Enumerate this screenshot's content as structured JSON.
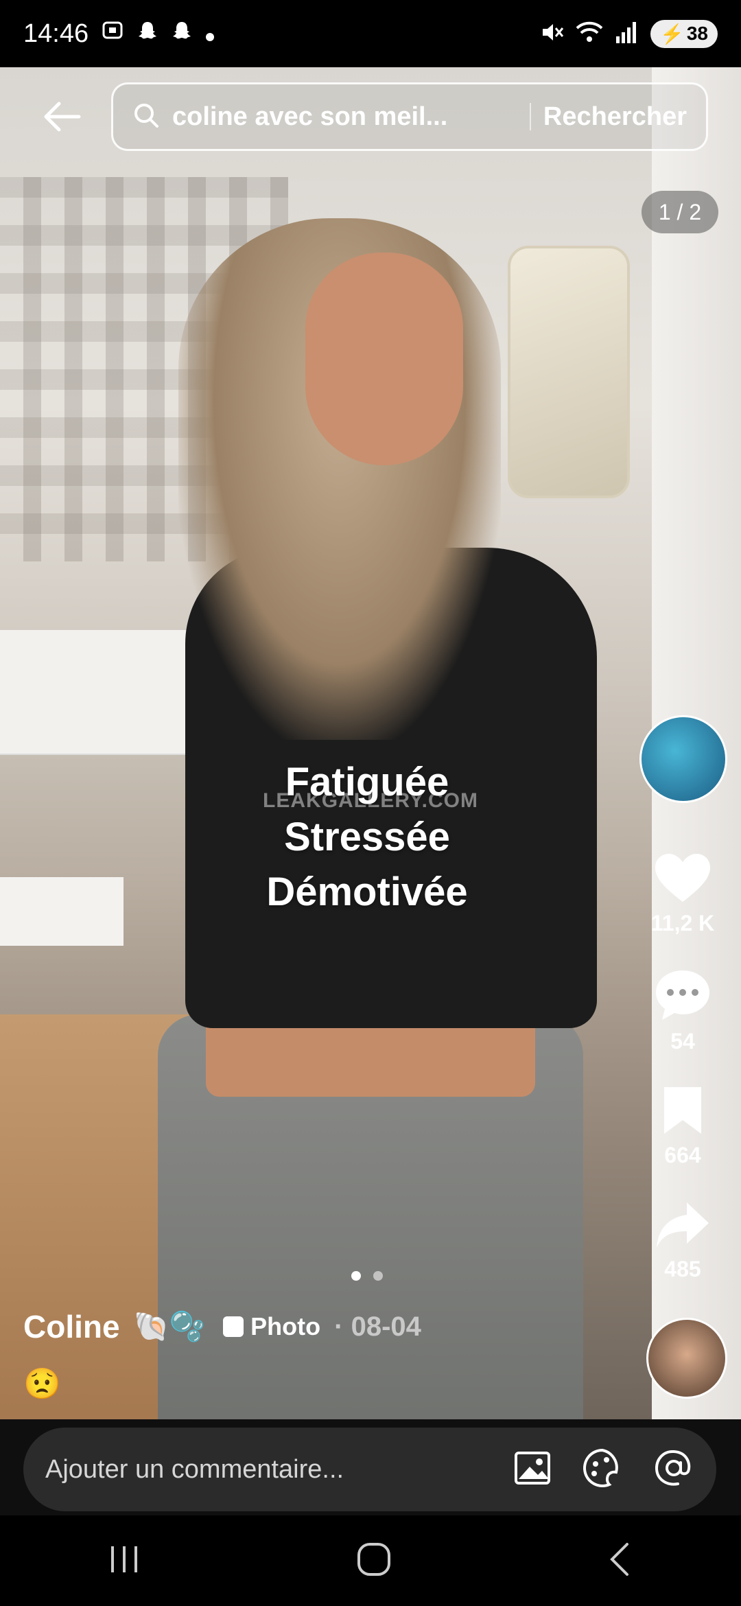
{
  "status": {
    "time": "14:46",
    "battery": "38"
  },
  "search": {
    "query": "coline avec son meil...",
    "button": "Rechercher"
  },
  "post": {
    "page_indicator": "1 / 2",
    "overlay_lines": [
      "Fatiguée",
      "Stressée",
      "Démotivée"
    ],
    "watermark": "LEAKGALLERY.COM",
    "author": "Coline",
    "author_emojis": "🐚🫧",
    "type_label": "Photo",
    "date": "· 08-04",
    "caption": "😟"
  },
  "actions": {
    "likes": "11,2 K",
    "comments": "54",
    "saves": "664",
    "shares": "485"
  },
  "comment_bar": {
    "placeholder": "Ajouter un commentaire..."
  }
}
